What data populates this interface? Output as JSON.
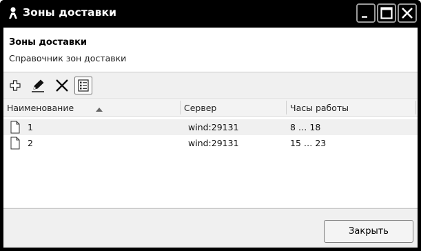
{
  "window": {
    "title": "Зоны доставки"
  },
  "header": {
    "title": "Зоны доставки",
    "subtitle": "Справочник зон доставки"
  },
  "toolbar": {
    "icons": [
      "add-icon",
      "edit-icon",
      "delete-icon",
      "properties-icon"
    ]
  },
  "table": {
    "columns": [
      "Наименование",
      "Сервер",
      "Часы работы"
    ],
    "sort": {
      "column": "Наименование",
      "direction": "ascending"
    },
    "rows": [
      {
        "name": "1",
        "server": "wind:29131",
        "hours": "8 … 18"
      },
      {
        "name": "2",
        "server": "wind:29131",
        "hours": "15 … 23"
      }
    ]
  },
  "footer": {
    "close_label": "Закрыть"
  },
  "colors": {
    "titlebar": "#000000",
    "panel": "#f0f0f0",
    "selected_row": "#f0f0f0"
  }
}
